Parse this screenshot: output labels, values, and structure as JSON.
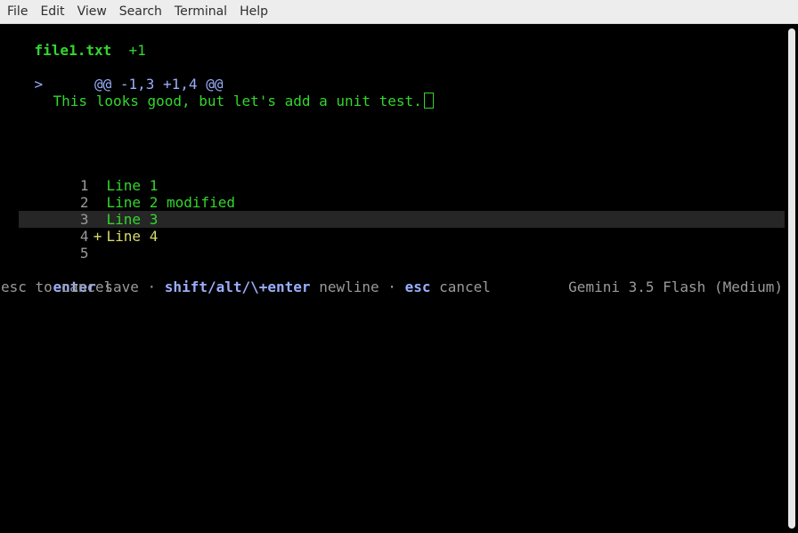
{
  "menu": {
    "file": "File",
    "edit": "Edit",
    "view": "View",
    "search": "Search",
    "terminal": "Terminal",
    "help": "Help"
  },
  "header": {
    "filename": "file1.txt",
    "added": "+1"
  },
  "hunk": {
    "prompt": ">",
    "range": "@@ -1,3 +1,4 @@"
  },
  "comment": {
    "text": "This looks good, but let's add a unit test."
  },
  "diff_lines": [
    {
      "num": "1",
      "marker": "",
      "text": "Line 1"
    },
    {
      "num": "2",
      "marker": "",
      "text": "Line 2 modified"
    },
    {
      "num": "3",
      "marker": "",
      "text": "Line 3"
    },
    {
      "num": "4",
      "marker": "+",
      "text": "Line 4"
    },
    {
      "num": "5",
      "marker": "",
      "text": ""
    }
  ],
  "hints": {
    "enter_key": "enter",
    "enter_action": "save",
    "sep1": "·",
    "newline_key": "shift/alt/\\+enter",
    "newline_action": "newline",
    "sep2": "·",
    "esc_key": "esc",
    "esc_action": "cancel"
  },
  "status": {
    "left": "esc to cancel",
    "model": "Gemini 3.5 Flash (Medium)"
  },
  "colors": {
    "background": "#000000",
    "text_green": "#33d62d",
    "text_blue": "#9aaefc",
    "text_gray": "#9a9a9a",
    "highlight_row": "#262626",
    "added_line": "#d6d96a"
  }
}
